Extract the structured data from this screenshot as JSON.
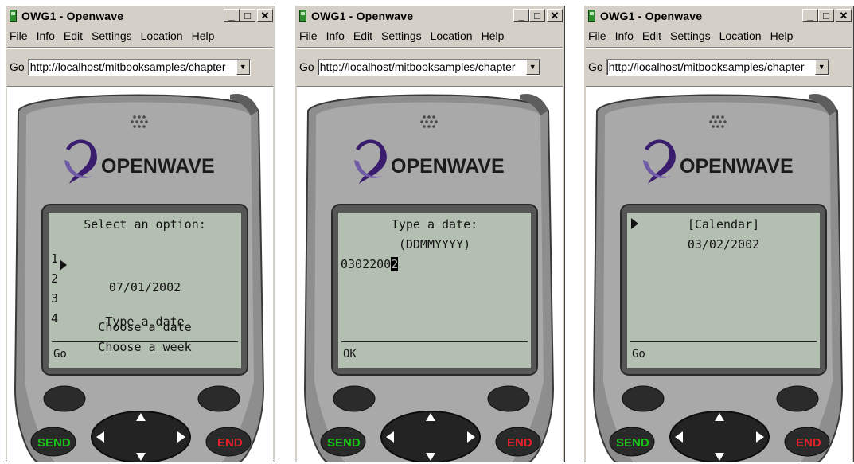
{
  "windows": [
    {
      "title": "OWG1 - Openwave",
      "menu": [
        "File",
        "Info",
        "Edit",
        "Settings",
        "Location",
        "Help"
      ],
      "go_label": "Go",
      "url": "http://localhost/mitbooksamples/chapter",
      "brand": "OPENWAVE",
      "keys": {
        "send": "SEND",
        "end": "END"
      },
      "screen": {
        "title": "Select an option:",
        "items": [
          {
            "num": "1",
            "label": "07/01/2002"
          },
          {
            "num": "2",
            "label": "Type a date"
          },
          {
            "num": "3",
            "label": "Choose a date"
          },
          {
            "num": "4",
            "label": "Choose a week"
          }
        ],
        "softkey": "Go"
      }
    },
    {
      "title": "OWG1 - Openwave",
      "menu": [
        "File",
        "Info",
        "Edit",
        "Settings",
        "Location",
        "Help"
      ],
      "go_label": "Go",
      "url": "http://localhost/mitbooksamples/chapter",
      "brand": "OPENWAVE",
      "keys": {
        "send": "SEND",
        "end": "END"
      },
      "screen": {
        "title": "Type a date:",
        "format": "(DDMMYYYY)",
        "input_text": "0302200",
        "input_cursor_char": "2",
        "softkey": "OK"
      }
    },
    {
      "title": "OWG1 - Openwave",
      "menu": [
        "File",
        "Info",
        "Edit",
        "Settings",
        "Location",
        "Help"
      ],
      "go_label": "Go",
      "url": "http://localhost/mitbooksamples/chapter",
      "brand": "OPENWAVE",
      "keys": {
        "send": "SEND",
        "end": "END"
      },
      "screen": {
        "link": "[Calendar]",
        "date": "03/02/2002",
        "softkey": "Go"
      }
    }
  ],
  "colors": {
    "send_key_text": "#19c419",
    "end_key_text": "#e0202a",
    "lcd": "#b3bfb0",
    "window_chrome": "#d4d0c8",
    "logo_purple": "#3a1c6e"
  }
}
